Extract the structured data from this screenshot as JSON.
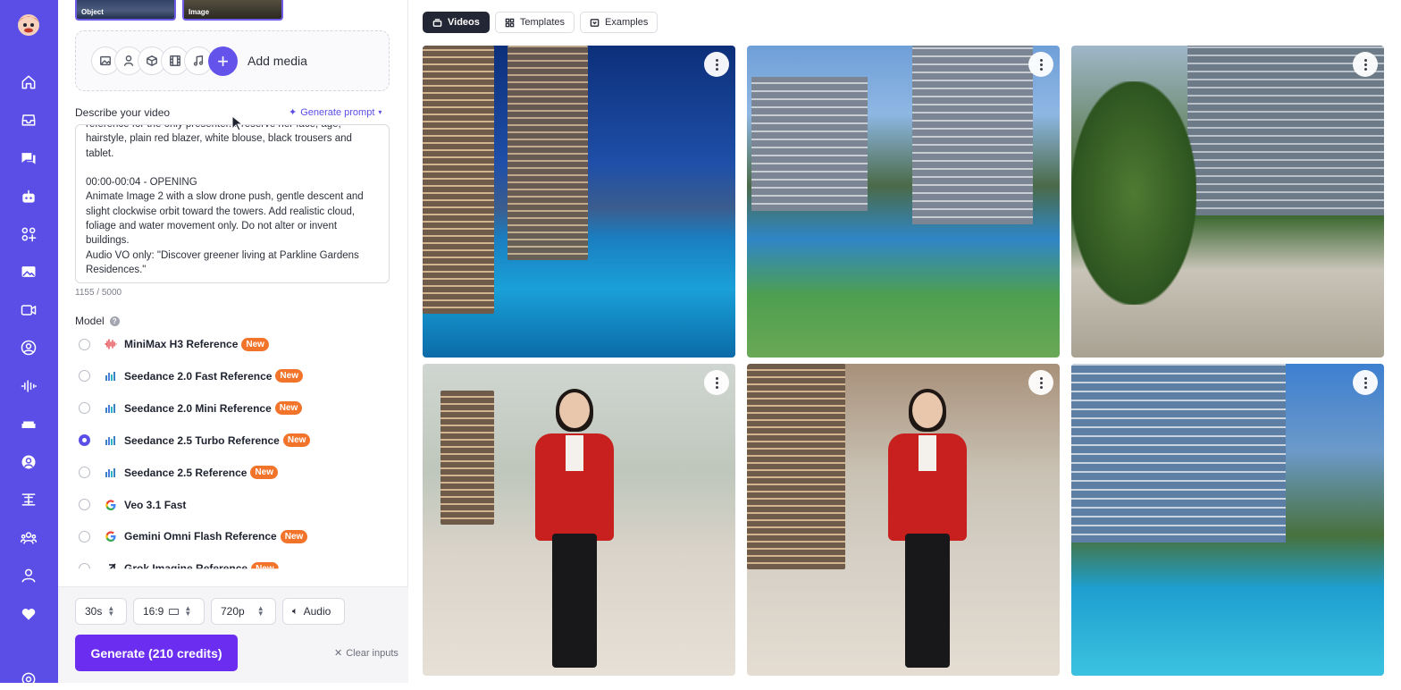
{
  "sidebar": {
    "icons": [
      "home-icon",
      "inbox-icon",
      "chat-icon",
      "robot-icon",
      "apps-icon",
      "image-gallery-icon",
      "video-camera-icon",
      "user-circle-icon",
      "audio-wave-icon",
      "couch-icon",
      "account-icon",
      "transform-icon",
      "team-icon",
      "person-icon",
      "heart-icon",
      "settings-icon"
    ]
  },
  "panel": {
    "uploads": [
      {
        "label": "Object"
      },
      {
        "label": "Image"
      }
    ],
    "add_media_label": "Add media",
    "describe_label": "Describe your video",
    "generate_prompt_label": "Generate prompt",
    "prompt_text": "reference for the only presenter. Preserve her face, age,\nhairstyle, plain red blazer, white blouse, black trousers and\ntablet.\n\n00:00-00:04 - OPENING\nAnimate Image 2 with a slow drone push, gentle descent and\nslight clockwise orbit toward the towers. Add realistic cloud,\nfoliage and water movement only. Do not alter or invent\nbuildings.\nAudio VO only: \"Discover greener living at Parkline Gardens\nResidences.\"",
    "char_count": "1155 / 5000",
    "model_label": "Model",
    "models": [
      {
        "name": "MiniMax H3 Reference",
        "badge": "New",
        "logo": "minimax-logo-icon",
        "selected": false
      },
      {
        "name": "Seedance 2.0 Fast Reference",
        "badge": "New",
        "logo": "seedance-logo-icon",
        "selected": false
      },
      {
        "name": "Seedance 2.0 Mini Reference",
        "badge": "New",
        "logo": "seedance-logo-icon",
        "selected": false
      },
      {
        "name": "Seedance 2.5 Turbo Reference",
        "badge": "New",
        "logo": "seedance-logo-icon",
        "selected": true
      },
      {
        "name": "Seedance 2.5 Reference",
        "badge": "New",
        "logo": "seedance-logo-icon",
        "selected": false
      },
      {
        "name": "Veo 3.1 Fast",
        "badge": "",
        "logo": "google-logo-icon",
        "selected": false
      },
      {
        "name": "Gemini Omni Flash Reference",
        "badge": "New",
        "logo": "google-logo-icon",
        "selected": false
      },
      {
        "name": "Grok Imagine Reference",
        "badge": "New",
        "logo": "grok-logo-icon",
        "selected": false
      }
    ],
    "duration": "30s",
    "aspect": "16:9",
    "resolution": "720p",
    "audio_label": "Audio",
    "generate_label": "Generate (210 credits)",
    "clear_label": "Clear inputs"
  },
  "main": {
    "tabs": [
      {
        "label": "Videos",
        "active": true,
        "icon": "videos-icon"
      },
      {
        "label": "Templates",
        "active": false,
        "icon": "templates-icon"
      },
      {
        "label": "Examples",
        "active": false,
        "icon": "examples-icon"
      }
    ],
    "cards": [
      "Night pool towers",
      "Aerial pool towers",
      "Garden walkway",
      "Presenter with tablet",
      "Presenter welcoming",
      "Pool and palms"
    ]
  },
  "colors": {
    "accent": "#5b4ee6",
    "generate": "#6b2ef0",
    "badge": "#f2742a"
  }
}
